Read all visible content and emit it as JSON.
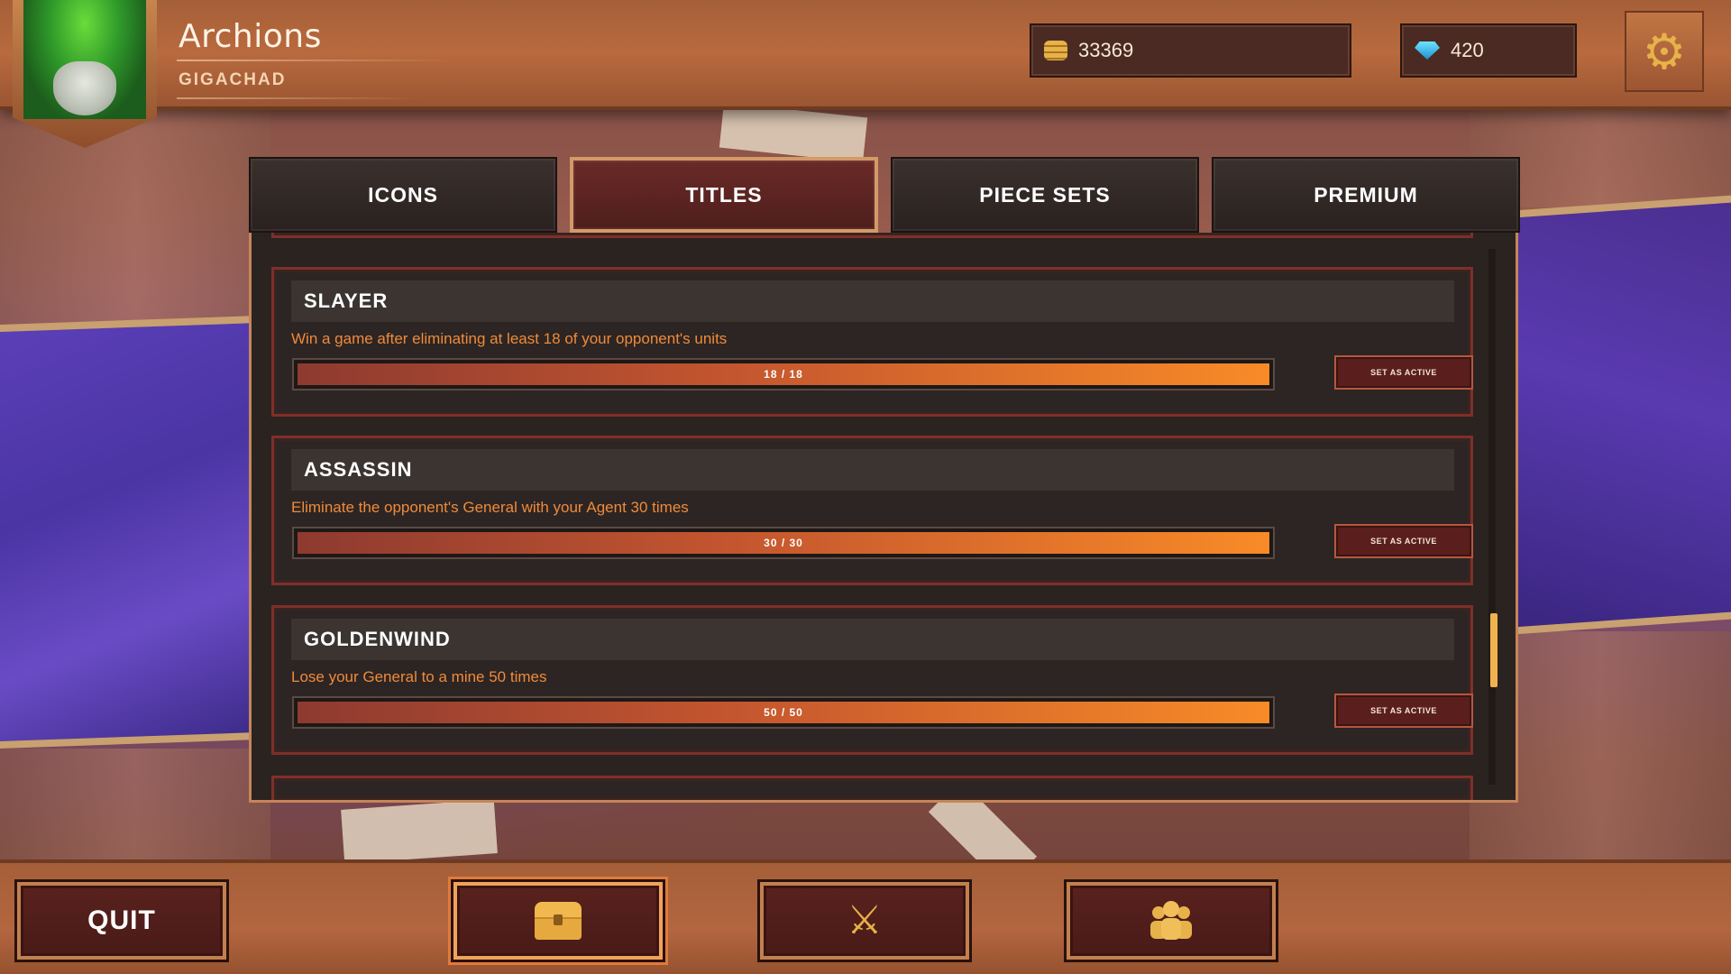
{
  "header": {
    "username": "Archions",
    "title": "GIGACHAD",
    "gold": "33369",
    "gems": "420",
    "avatar_icon": "mushroom-character-avatar",
    "settings_icon": "gear-icon"
  },
  "tabs": [
    {
      "label": "ICONS",
      "active": false
    },
    {
      "label": "TITLES",
      "active": true
    },
    {
      "label": "PIECE SETS",
      "active": false
    },
    {
      "label": "PREMIUM",
      "active": false
    }
  ],
  "titles": [
    {
      "name": "SLAYER",
      "description": "Win a game after eliminating at least 18 of your opponent's units",
      "progress_text": "18 / 18",
      "progress_fraction": 1.0,
      "button": "SET AS ACTIVE"
    },
    {
      "name": "ASSASSIN",
      "description": "Eliminate the opponent's General with your Agent 30 times",
      "progress_text": "30 / 30",
      "progress_fraction": 1.0,
      "button": "SET AS ACTIVE"
    },
    {
      "name": "GOLDENWIND",
      "description": "Lose your General to a mine 50 times",
      "progress_text": "50 / 50",
      "progress_fraction": 1.0,
      "button": "SET AS ACTIVE"
    }
  ],
  "bottom_nav": {
    "quit_label": "QUIT",
    "shop_icon": "chest-icon",
    "battle_icon": "crossed-swords-icon",
    "social_icon": "people-icon"
  },
  "colors": {
    "accent_orange": "#f88b27",
    "description_text": "#f08a3a",
    "gold_icon": "#e7b24a",
    "gem_icon": "#1d8fd1"
  }
}
